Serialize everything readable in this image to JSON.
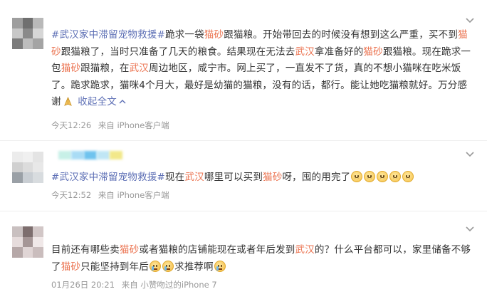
{
  "posts": [
    {
      "segments": [
        {
          "t": "#武汉家中滞留宠物救援#",
          "c": "link"
        },
        {
          "t": "跪求一袋"
        },
        {
          "t": "猫砂",
          "c": "hl"
        },
        {
          "t": "跟猫粮。开始带回去的时候没有想到这么严重，买不到"
        },
        {
          "t": "猫砂",
          "c": "hl"
        },
        {
          "t": "跟猫粮了，当时只准备了几天的粮食。结果现在无法去"
        },
        {
          "t": "武汉",
          "c": "hl"
        },
        {
          "t": "拿准备好的"
        },
        {
          "t": "猫砂",
          "c": "hl"
        },
        {
          "t": "跟猫粮。现在跪求一包"
        },
        {
          "t": "猫砂",
          "c": "hl"
        },
        {
          "t": "跟猫粮，在"
        },
        {
          "t": "武汉",
          "c": "hl"
        },
        {
          "t": "周边地区，咸宁市。网上买了，一直发不了货，真的不想小猫咪在吃米饭了。跪求跪求，猫咪4个月大，最好是幼猫的猫粮，没有的话，都行。能让她吃猫粮就好。万分感谢"
        },
        {
          "e": "pray"
        },
        {
          "t": " "
        },
        {
          "t": "收起全文",
          "c": "link"
        },
        {
          "e": "up"
        }
      ],
      "time": "今天12:26",
      "source": "来自 iPhone客户端"
    },
    {
      "segments": [
        {
          "t": "#武汉家中滞留宠物救援#",
          "c": "link"
        },
        {
          "t": "现在"
        },
        {
          "t": "武汉",
          "c": "hl"
        },
        {
          "t": "哪里可以买到"
        },
        {
          "t": "猫砂",
          "c": "hl"
        },
        {
          "t": "呀，囤的用完了"
        },
        {
          "e": "sad"
        },
        {
          "e": "sad"
        },
        {
          "e": "sad"
        },
        {
          "e": "sad"
        },
        {
          "e": "sad"
        }
      ],
      "time": "今天12:52",
      "source": "来自 iPhone客户端"
    },
    {
      "segments": [
        {
          "t": "目前还有哪些卖"
        },
        {
          "t": "猫砂",
          "c": "hl"
        },
        {
          "t": "或者猫粮的店铺能现在或者年后发到"
        },
        {
          "t": "武汉",
          "c": "hl"
        },
        {
          "t": "的？什么平台都可以，家里储备不够了"
        },
        {
          "t": "猫砂",
          "c": "hl"
        },
        {
          "t": "只能坚持到年后"
        },
        {
          "e": "cry"
        },
        {
          "e": "cry"
        },
        {
          "t": "求推荐啊"
        },
        {
          "e": "cry"
        }
      ],
      "time": "01月26日 20:21",
      "source": "来自 小赞吻过的iPhone 7"
    }
  ],
  "colors": {
    "highlight": "#eb7350",
    "link": "#5d6fb5",
    "meta": "#999999"
  }
}
